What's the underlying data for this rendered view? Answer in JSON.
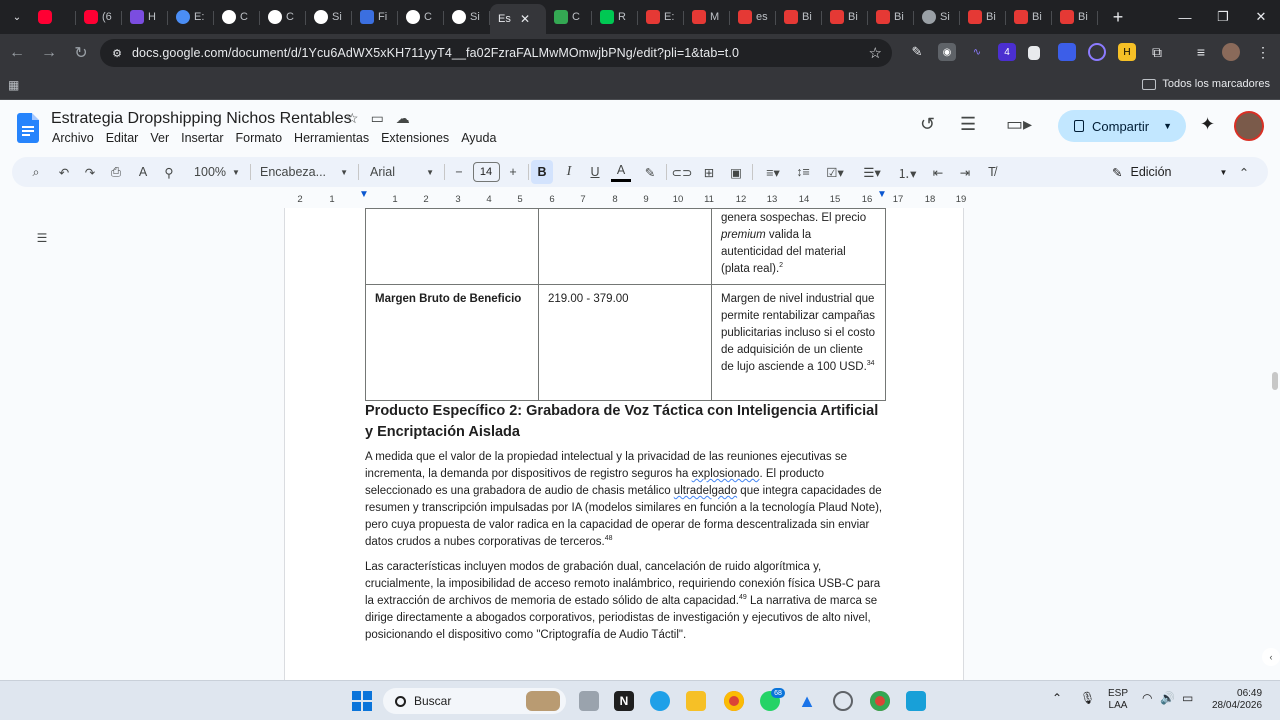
{
  "browser": {
    "tab_titles": [
      "(6",
      "H",
      "E:",
      "C",
      "C",
      "Si",
      "Fi",
      "C",
      "Si",
      "Es",
      "C",
      "R",
      "E:",
      "M",
      "es",
      "Bi",
      "Bi",
      "Bi",
      "Si",
      "Bi",
      "Bi",
      "Bi"
    ],
    "active_tab_title": "Es",
    "url": "docs.google.com/document/d/1Ycu6AdWX5xKH711yyT4__fa02FzraFALMwMOmwjbPNg/edit?pli=1&tab=t.0",
    "all_bookmarks_label": "Todos los marcadores",
    "extension_badge": "4"
  },
  "doc": {
    "title": "Estrategia Dropshipping Nichos Rentables",
    "menu": [
      "Archivo",
      "Editar",
      "Ver",
      "Insertar",
      "Formato",
      "Herramientas",
      "Extensiones",
      "Ayuda"
    ],
    "share_label": "Compartir",
    "zoom": "100%",
    "style": "Encabeza...",
    "font": "Arial",
    "font_size": "14",
    "mode": "Edición",
    "ruler_ticks": [
      "2",
      "1",
      "1",
      "2",
      "3",
      "4",
      "5",
      "6",
      "7",
      "8",
      "9",
      "10",
      "11",
      "12",
      "13",
      "14",
      "15",
      "16",
      "17",
      "18",
      "19"
    ]
  },
  "content": {
    "row_prev": {
      "col3_a": "genera sospechas. El precio ",
      "col3_em": "premium",
      "col3_b": " valida la autenticidad del material (plata real).",
      "col3_sup": "2"
    },
    "row_margin": {
      "label": "Margen Bruto de Beneficio",
      "value": "219.00 - 379.00",
      "note": "Margen de nivel industrial que permite rentabilizar campañas publicitarias incluso si el costo de adquisición de un cliente de lujo asciende a 100 USD.",
      "note_sup": "34"
    },
    "heading": "Producto Específico 2: Grabadora de Voz Táctica con Inteligencia Artificial y Encriptación Aislada",
    "p1_a": "A medida que el valor de la propiedad intelectual y la privacidad de las reuniones ejecutivas se incrementa, la demanda por dispositivos de registro seguros ha ",
    "p1_w1": "explosionado",
    "p1_b": ". El producto seleccionado es una grabadora de audio de chasis metálico ",
    "p1_w2": "ultradelgado",
    "p1_c": " que integra capacidades de resumen y transcripción impulsadas por IA (modelos similares en función a la tecnología Plaud Note), pero cuya propuesta de valor radica en la capacidad de operar de forma descentralizada sin enviar datos crudos a nubes corporativas de terceros.",
    "p1_sup": "48",
    "p2_a": "Las características incluyen modos de grabación dual, cancelación de ruido algorítmica y, crucialmente, la imposibilidad de acceso remoto inalámbrico, requiriendo conexión física USB-C para la extracción de archivos de memoria de estado sólido de alta capacidad.",
    "p2_sup": "49",
    "p2_b": " La narrativa de marca se dirige directamente a abogados corporativos, periodistas de investigación y ejecutivos de alto nivel, posicionando el dispositivo como \"Criptografía de Audio Táctil\"."
  },
  "taskbar": {
    "search_label": "Buscar",
    "whatsapp_badge": "68",
    "lang_top": "ESP",
    "lang_bottom": "LAA",
    "time": "06:49",
    "date": "28/04/2026"
  },
  "colors": {
    "accent": "#0b57d0",
    "share_bg": "#c2e7ff",
    "chrome_dark": "#202124"
  }
}
